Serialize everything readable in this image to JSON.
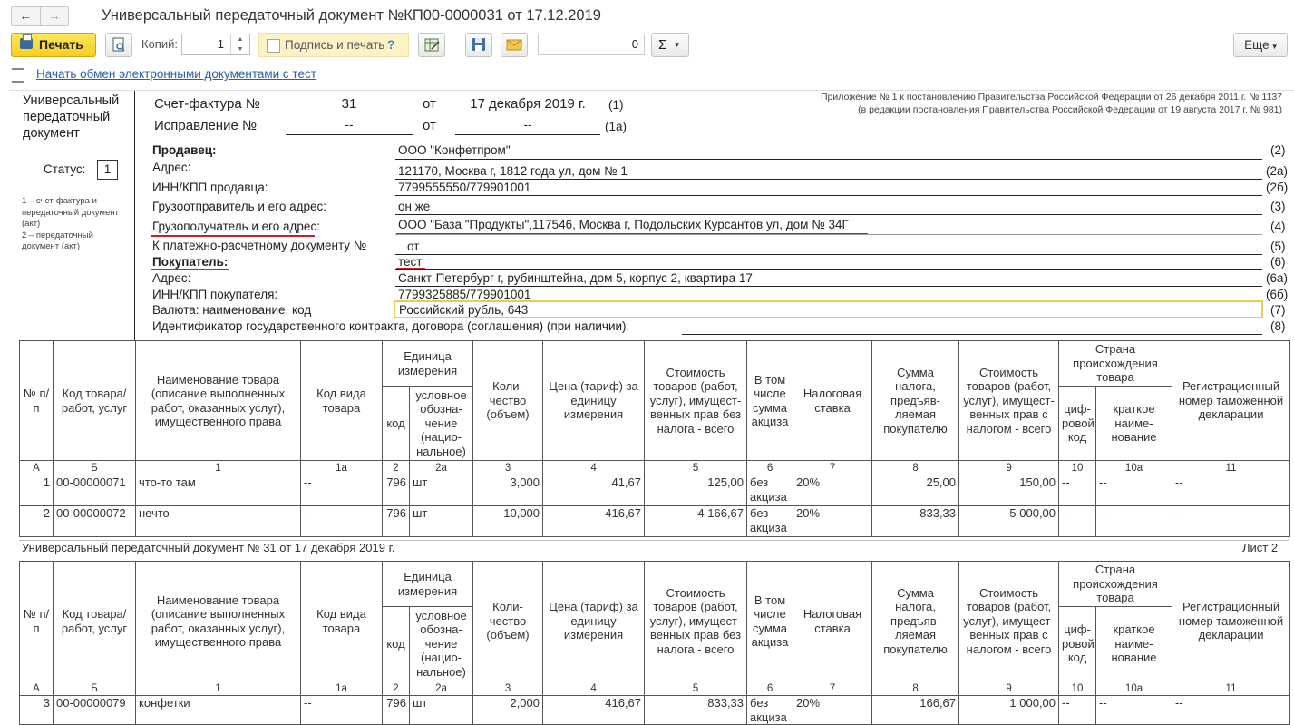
{
  "window": {
    "title": "Универсальный передаточный документ №КП00-0000031 от 17.12.2019",
    "back": "←",
    "forward": "→"
  },
  "toolbar": {
    "print_label": "Печать",
    "copies_label": "Копий:",
    "copies_value": "1",
    "sign_print_label": "Подпись и печать",
    "help": "?",
    "count_value": "0",
    "sigma": "Σ",
    "more_label": "Еще"
  },
  "edo_link": "Начать обмен электронными документами с тест",
  "doc": {
    "upd_title": [
      "Универсальный",
      "передаточный",
      "документ"
    ],
    "status_label": "Статус:",
    "status_value": "1",
    "status_notes": [
      "1 – счет-фактура и",
      "передаточный документ",
      "(акт)",
      "2 – передаточный",
      "документ (акт)"
    ],
    "invoice_label": "Счет-фактура №",
    "invoice_no": "31",
    "ot": "от",
    "invoice_date": "17 декабря 2019 г.",
    "n1": "(1)",
    "correction_label": "Исправление №",
    "correction_no": "--",
    "correction_date": "--",
    "n1a": "(1а)",
    "appendix_1": "Приложение № 1 к постановлению Правительства Российской Федерации от 26 декабря 2011 г. № 1137",
    "appendix_2": "(в редакции постановления Правительства Российской Федерации от 19 августа 2017 г. № 981)",
    "fields": [
      {
        "label": "Продавец:",
        "value": "ООО \"Конфетпром\"",
        "num": "(2)"
      },
      {
        "label": "Адрес:",
        "value": "121170, Москва г, 1812 года ул, дом № 1",
        "num": "(2а)"
      },
      {
        "label": "ИНН/КПП продавца:",
        "value": "7799555550/779901001",
        "num": "(2б)"
      },
      {
        "label": "Грузоотправитель и его адрес:",
        "value": "он же",
        "num": "(3)"
      },
      {
        "label": "Грузополучатель и его адрес:",
        "value": "ООО \"База \"Продукты\",117546, Москва г, Подольских Курсантов ул, дом № 34Г",
        "num": "(4)"
      },
      {
        "label": "К платежно-расчетному документу №",
        "value": "от",
        "num": "(5)"
      },
      {
        "label": "Покупатель:",
        "value": "тест",
        "num": "(6)"
      },
      {
        "label": "Адрес:",
        "value": "Санкт-Петербург г, рубинштейна, дом 5, корпус 2, квартира 17",
        "num": "(6а)"
      },
      {
        "label": "ИНН/КПП покупателя:",
        "value": "7799325885/779901001",
        "num": "(6б)"
      },
      {
        "label": "Валюта: наименование, код",
        "value": "Российский рубль, 643",
        "num": "(7)"
      },
      {
        "label": "Идентификатор государственного контракта, договора (соглашения) (при наличии):",
        "value": "",
        "num": "(8)"
      }
    ]
  },
  "table": {
    "headers": {
      "num": "№ п/п",
      "code": "Код товара/ работ, услуг",
      "name": "Наименование товара (описание выполненных работ, оказанных услуг), имущественного права",
      "kind": "Код вида товара",
      "unit": "Единица измерения",
      "unit_code": "код",
      "unit_name": "условное обозна-чение (нацио-нальное)",
      "qty": "Коли-чество (объем)",
      "price": "Цена (тариф) за единицу измерения",
      "cost": "Стоимость товаров (работ, услуг), имущест-венных прав без налога - всего",
      "excise": "В том числе сумма акциза",
      "rate": "Налоговая ставка",
      "tax": "Сумма налога, предъяв-ляемая покупателю",
      "total": "Стоимость товаров (работ, услуг), имущест-венных прав с налогом - всего",
      "country": "Страна происхождения товара",
      "country_code": "циф-ровой код",
      "country_name": "краткое наиме-нование",
      "decl": "Регистрационный номер таможенной декларации"
    },
    "col_numbers": [
      "А",
      "Б",
      "1",
      "1а",
      "2",
      "2а",
      "3",
      "4",
      "5",
      "6",
      "7",
      "8",
      "9",
      "10",
      "10а",
      "11"
    ],
    "rows_sheet1": [
      {
        "n": "1",
        "code": "00-00000071",
        "name": "что-то там",
        "kind": "--",
        "ucode": "796",
        "uname": "шт",
        "qty": "3,000",
        "price": "41,67",
        "cost": "125,00",
        "excise": "без акциза",
        "rate": "20%",
        "tax": "25,00",
        "total": "150,00",
        "cc": "--",
        "cn": "--",
        "decl": "--"
      },
      {
        "n": "2",
        "code": "00-00000072",
        "name": "нечто",
        "kind": "--",
        "ucode": "796",
        "uname": "шт",
        "qty": "10,000",
        "price": "416,67",
        "cost": "4 166,67",
        "excise": "без акциза",
        "rate": "20%",
        "tax": "833,33",
        "total": "5 000,00",
        "cc": "--",
        "cn": "--",
        "decl": "--"
      }
    ],
    "sheet2_caption": "Универсальный передаточный документ № 31 от 17 декабря 2019 г.",
    "sheet2_label": "Лист 2",
    "rows_sheet2": [
      {
        "n": "3",
        "code": "00-00000079",
        "name": "конфетки",
        "kind": "--",
        "ucode": "796",
        "uname": "шт",
        "qty": "2,000",
        "price": "416,67",
        "cost": "833,33",
        "excise": "без акциза",
        "rate": "20%",
        "tax": "166,67",
        "total": "1 000,00",
        "cc": "--",
        "cn": "--",
        "decl": "--"
      }
    ]
  }
}
